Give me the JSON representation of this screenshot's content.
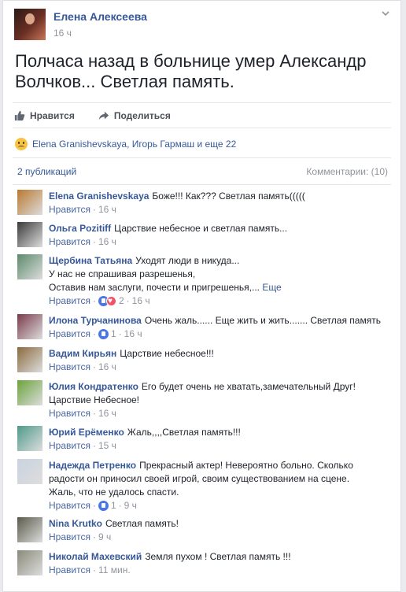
{
  "post": {
    "author": "Елена Алексеева",
    "time": "16 ч",
    "text": "Полчаса назад в больнице умер Александр Волчков... Светлая память.",
    "actions": {
      "like": "Нравится",
      "share": "Поделиться"
    },
    "reactions_text": "Elena Granishevskaya, Игорь Гармаш и еще 22",
    "publications": "2 публикаций",
    "comments_label": "Комментарии: (10)"
  },
  "comments": [
    {
      "name": "Elena Granishevskaya",
      "text": "Боже!!! Как??? Светлая память(((((",
      "like": "Нравится",
      "sep": "·",
      "time": "16 ч",
      "avatar": "#b9792e"
    },
    {
      "name": "Ольга Pozitiff",
      "text": "Царствие небесное и светлая память...",
      "like": "Нравится",
      "sep": "·",
      "time": "16 ч",
      "avatar": "#3a3a3a"
    },
    {
      "name": "Щербина Татьяна",
      "text": "Уходят люди в никуда...",
      "text2": "У нас не спрашивая разрешенья,",
      "text3": "Оставив нам заслуги, почести и пригрешенья,...",
      "more": "Еще",
      "like": "Нравится",
      "sep": "·",
      "count": "2",
      "sep2": "·",
      "time": "16 ч",
      "avatar": "#5b8a6b"
    },
    {
      "name": "Илона Турчанинова",
      "text": "Очень жаль...... Еще жить и жить....... Светлая память",
      "like": "Нравится",
      "sep": "·",
      "count": "1",
      "sep2": "·",
      "time": "16 ч",
      "avatar": "#7a3a4a"
    },
    {
      "name": "Вадим Кирьян",
      "text": "Царствие небесное!!!",
      "like": "Нравится",
      "sep": "·",
      "time": "16 ч",
      "avatar": "#8b6a3e"
    },
    {
      "name": "Юлия Кондратенко",
      "text": "Его будет очень не хватать,замечательный Друг!",
      "text2": "Царствие Небесное!",
      "like": "Нравится",
      "sep": "·",
      "time": "16 ч",
      "avatar": "#6aa33a"
    },
    {
      "name": "Юрий Ерёменко",
      "text": "Жаль,,,,Светлая память!!!",
      "like": "Нравится",
      "sep": "·",
      "time": "15 ч",
      "avatar": "#4d9a8a"
    },
    {
      "name": "Надежда Петренко",
      "text": "Прекрасный актер! Невероятно больно. Сколько",
      "text2": "радости он приносил своей игрой, своим существованием на сцене.",
      "text3": "Жаль, что не удалось спасти.",
      "like": "Нравится",
      "sep": "·",
      "count": "1",
      "sep2": "·",
      "time": "9 ч",
      "avatar": "#c9d3e0"
    },
    {
      "name": "Nina Krutko",
      "text": "Светлая память!",
      "like": "Нравится",
      "sep": "·",
      "time": "9 ч",
      "avatar": "#5a5a4a"
    },
    {
      "name": "Николай Махевский",
      "text": "Земля пухом ! Светлая память !!!",
      "like": "Нравится",
      "sep": "·",
      "time": "11 мин.",
      "avatar": "#8a8a7a"
    }
  ],
  "colors": {
    "link": "#365899",
    "meta": "#90949c"
  },
  "icons": {
    "like": "thumbs-up-icon",
    "share": "share-arrow-icon",
    "menu": "chevron-down-icon",
    "reaction": "sad-emoji-icon"
  }
}
